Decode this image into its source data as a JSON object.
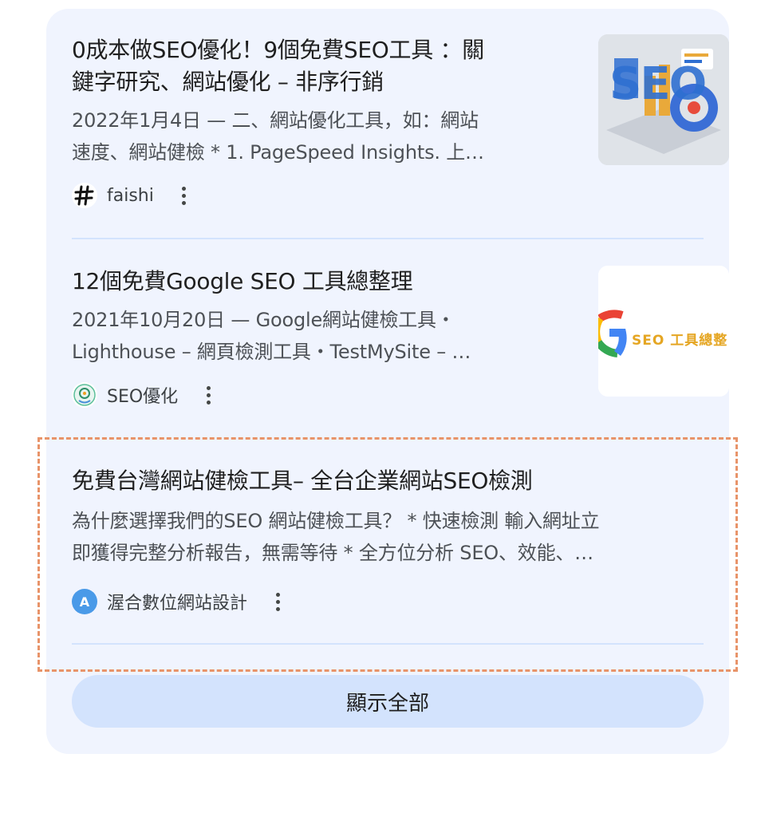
{
  "results": [
    {
      "title_line1": "0成本做SEO優化！9個免費SEO工具 ：關",
      "title_line2": "鍵字研究、網站優化 – 非序行銷",
      "snippet_line1": "2022年1月4日 — 二、網站優化工具，如：網站",
      "snippet_line2": "速度、網站健檢 * 1. PageSpeed Insights. 上…",
      "source": "faishi",
      "favicon_icon": "hash-icon",
      "thumbnail_text": "SEO"
    },
    {
      "title_line1": "12個免費Google SEO 工具總整理",
      "snippet_line1": "2021年10月20日 — Google網站健檢工具・",
      "snippet_line2": "Lighthouse – 網頁檢測工具・TestMySite – …",
      "source": "SEO優化",
      "favicon_icon": "robot-icon",
      "thumbnail_text": "SEO 工具總整"
    },
    {
      "title_line1": "免費台灣網站健檢工具– 全台企業網站SEO檢測",
      "snippet_line1": "為什麼選擇我們的SEO 網站健檢工具？ * 快速檢測 輸入網址立",
      "snippet_line2": "即獲得完整分析報告，無需等待 * 全方位分析 SEO、效能、…",
      "source": "渥合數位網站設計",
      "favicon_icon": "letter-a-icon",
      "favicon_letter": "A"
    }
  ],
  "show_all_label": "顯示全部",
  "colors": {
    "card_bg": "#f0f4fe",
    "divider": "#d3e3fd",
    "button_bg": "#d3e3fd",
    "highlight_border": "#e8946a"
  }
}
